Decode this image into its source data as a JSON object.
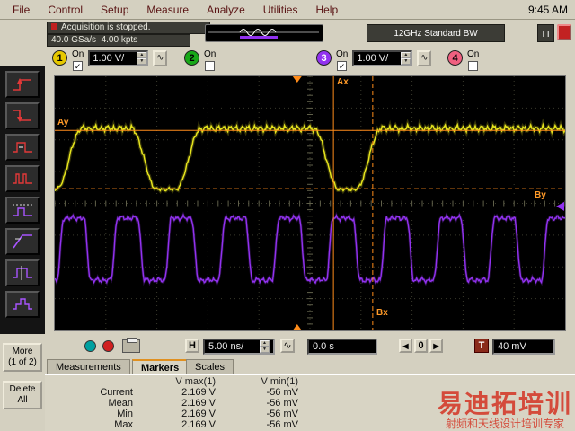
{
  "menu": {
    "items": [
      "File",
      "Control",
      "Setup",
      "Measure",
      "Analyze",
      "Utilities",
      "Help"
    ],
    "clock": "9:45 AM"
  },
  "status": {
    "acquisition": "Acquisition is stopped.",
    "sample_rate": "40.0 GSa/s",
    "memory": "4.00 kpts",
    "bandwidth": "12GHz Standard BW"
  },
  "channels": [
    {
      "num": "1",
      "on_label": "On",
      "scale": "1.00 V/",
      "enabled": true
    },
    {
      "num": "2",
      "on_label": "On",
      "enabled": false
    },
    {
      "num": "3",
      "on_label": "On",
      "scale": "1.00 V/",
      "enabled": true
    },
    {
      "num": "4",
      "on_label": "On",
      "enabled": false
    }
  ],
  "markers": {
    "ax": "Ax",
    "ay": "Ay",
    "bx": "Bx",
    "by": "By"
  },
  "hbar": {
    "h_label": "H",
    "timebase": "5.00 ns/",
    "position": "0.0 s",
    "zero_label": "0",
    "trigger_label": "T",
    "trigger_level": "40 mV"
  },
  "tabs": {
    "measurements": "Measurements",
    "markers": "Markers",
    "scales": "Scales"
  },
  "results": {
    "headers": {
      "vmax": "V max(1)",
      "vmin": "V min(1)"
    },
    "rows": [
      {
        "name": "Current",
        "vmax": "2.169 V",
        "vmin": "-56 mV"
      },
      {
        "name": "Mean",
        "vmax": "2.169 V",
        "vmin": "-56 mV"
      },
      {
        "name": "Min",
        "vmax": "2.169 V",
        "vmin": "-56 mV"
      },
      {
        "name": "Max",
        "vmax": "2.169 V",
        "vmin": "-56 mV"
      }
    ]
  },
  "sidebar": {
    "more_line1": "More",
    "more_line2": "(1 of 2)",
    "delete_line1": "Delete",
    "delete_line2": "All"
  },
  "watermark": {
    "line1": "易迪拓培训",
    "line2": "射频和天线设计培训专家"
  },
  "icons": {
    "left_arrow": "◀",
    "right_arrow": "▶",
    "up": "▲",
    "down": "▼",
    "ac": "∿",
    "check": "✓",
    "pulse": "⊓"
  },
  "colors": {
    "ch1": "#e6c800",
    "ch2": "#18a818",
    "ch3": "#9232f0",
    "ch4": "#f06080",
    "marker": "#ff8c1a"
  },
  "scope": {
    "grid_color": "#3a3a2c",
    "axis_color": "#60604a",
    "marker_color": "#ff8c1a",
    "ch1": {
      "color": "#e6e41e",
      "high": 0.205,
      "low": 0.445,
      "start_level": 0,
      "trans": 0.05,
      "edges": [
        [
          0.028,
          1
        ],
        [
          0.175,
          0
        ],
        [
          0.262,
          1
        ],
        [
          0.532,
          0
        ],
        [
          0.615,
          1
        ]
      ]
    },
    "ch3": {
      "color": "#9232f0",
      "high": 0.558,
      "low": 0.802,
      "period": 0.1055,
      "phase": 0.004,
      "edge": 0.13
    },
    "markers": {
      "ax": 0.546,
      "bx": 0.623,
      "ay": 0.213,
      "by": 0.442,
      "trig": 0.475,
      "ch3_ref": 0.512
    }
  }
}
